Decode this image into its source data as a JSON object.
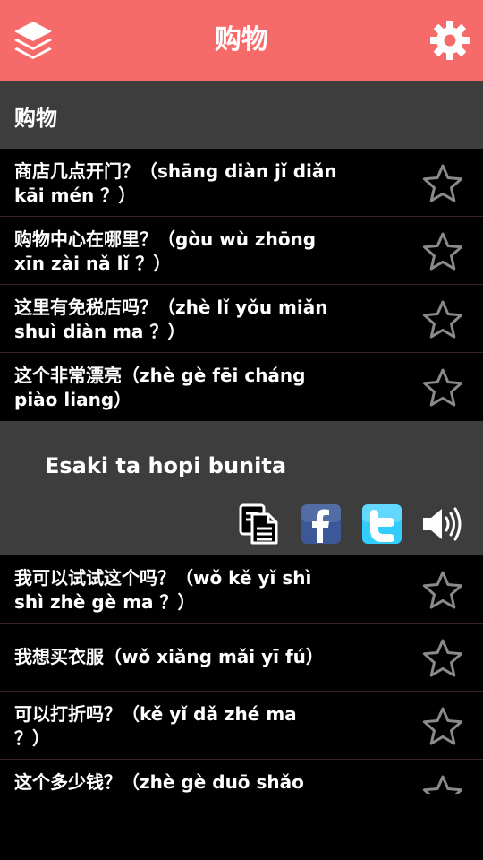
{
  "appbar": {
    "title": "购物"
  },
  "section": {
    "title": "购物"
  },
  "phrases_top": [
    {
      "line1": "商店几点开门？（shāng diàn jǐ diǎn",
      "line2": "kāi mén ？）"
    },
    {
      "line1": "购物中心在哪里？（gòu wù zhōng",
      "line2": "xīn zài nǎ lǐ ？）"
    },
    {
      "line1": "这里有免税店吗？（zhè lǐ yǒu miǎn",
      "line2": "shuì diàn ma ？）"
    },
    {
      "line1": "这个非常漂亮（zhè gè fēi cháng",
      "line2": "piào liang）"
    }
  ],
  "detail": {
    "translation": "Esaki ta hopi bunita"
  },
  "phrases_bottom": [
    {
      "line1": "我可以试试这个吗？（wǒ kě yǐ shì",
      "line2": "shì zhè gè ma ？）"
    },
    {
      "line1": "我想买衣服（wǒ xiǎng mǎi yī fú）",
      "line2": ""
    },
    {
      "line1": "可以打折吗？（kě yǐ dǎ zhé ma",
      "line2": "？）"
    },
    {
      "line1": "这个多少钱？（zhè gè duō shǎo",
      "line2": ""
    }
  ],
  "icons": {
    "menu": "layers-icon",
    "settings": "gear-icon",
    "favorite": "star-outline-icon",
    "copy": "copy-icon",
    "facebook": "facebook-icon",
    "twitter": "twitter-icon",
    "speak": "speaker-icon"
  },
  "colors": {
    "appbar": "#f76a6a",
    "panel": "#3d3d3d",
    "background": "#000000",
    "facebook": "#3b5998",
    "twitter": "#33ccff"
  }
}
